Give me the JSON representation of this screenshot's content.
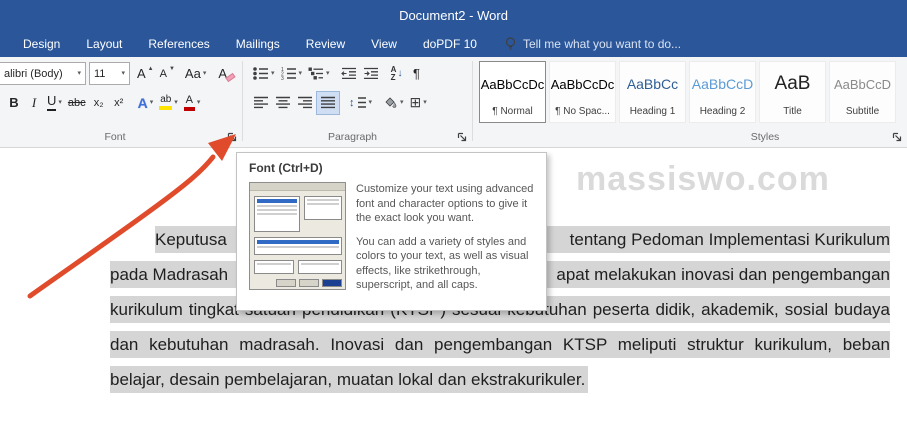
{
  "title_bar": {
    "title": "Document2 - Word"
  },
  "ribbon": {
    "tabs": [
      "Design",
      "Layout",
      "References",
      "Mailings",
      "Review",
      "View",
      "doPDF 10"
    ],
    "tell_me": "Tell me what you want to do...",
    "font_group": {
      "label": "Font",
      "font_name": "alibri (Body)",
      "font_size": "11"
    },
    "paragraph_group": {
      "label": "Paragraph"
    },
    "styles_group": {
      "label": "Styles",
      "styles": [
        {
          "preview": "AaBbCcDc",
          "name": "¶ Normal"
        },
        {
          "preview": "AaBbCcDc",
          "name": "¶ No Spac..."
        },
        {
          "preview": "AaBbCc",
          "name": "Heading 1"
        },
        {
          "preview": "AaBbCcD",
          "name": "Heading 2"
        },
        {
          "preview": "AaB",
          "name": "Title"
        },
        {
          "preview": "AaBbCcD",
          "name": "Subtitle"
        }
      ]
    },
    "icons": {
      "caret": "▾",
      "grow_mark": "▲",
      "shrink_mark": "▼",
      "letter_a": "A",
      "change_case": "Aa",
      "bold": "B",
      "italic": "I",
      "underline": "U",
      "strikethrough": "abc",
      "subscript": "x₂",
      "superscript": "x²",
      "text_effects": "A",
      "highlight": "ab",
      "font_color": "A",
      "pilcrow": "¶",
      "borders": "⊞",
      "sort_a": "A",
      "sort_z": "Z",
      "down_arrow": "↓",
      "updown_arrow": "↕"
    }
  },
  "tooltip": {
    "title": "Font (Ctrl+D)",
    "paragraph_1": "Customize your text using advanced font and character options to give it the exact look you want.",
    "paragraph_2": "You can add a variety of styles and colors to your text, as well as visual effects, like strikethrough, superscript, and all caps."
  },
  "watermark": "massiswo.com",
  "document": {
    "lines": [
      {
        "left": "Keputusa",
        "right": "tentang Pedoman Implementasi Kurikulum"
      },
      {
        "left": "pada Madrasah",
        "right": "apat melakukan inovasi dan pengembangan"
      },
      {
        "text": "kurikulum tingkat satuan pendidikan (KTSP) sesuai kebutuhan peserta didik, akademik, sosial budaya"
      },
      {
        "text": "dan kebutuhan madrasah. Inovasi dan pengembangan KTSP meliputi struktur kurikulum, beban"
      },
      {
        "text": "belajar, desain pembelajaran, muatan lokal dan ekstrakurikuler."
      }
    ]
  },
  "colors": {
    "title_bar": "#2b579a",
    "selection": "#d5d5d5",
    "arrow": "#e04b2c",
    "highlight_yellow": "#ffe400",
    "font_color_red": "#c00000",
    "heading1": "#2e5e95",
    "heading2": "#5b9bd5"
  }
}
